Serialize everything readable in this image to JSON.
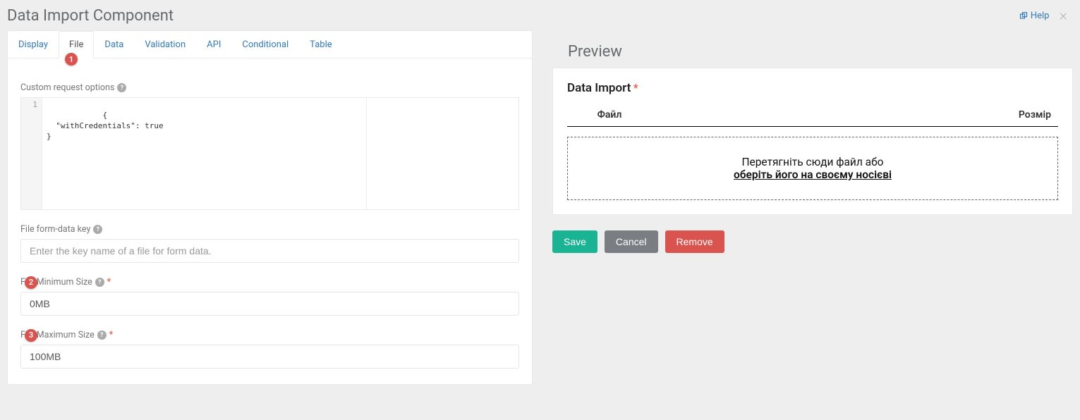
{
  "header": {
    "title": "Data Import Component",
    "help_label": "Help"
  },
  "tabs": {
    "display": "Display",
    "file": "File",
    "data": "Data",
    "validation": "Validation",
    "api": "API",
    "conditional": "Conditional",
    "table": "Table",
    "active": "file"
  },
  "badges": {
    "tab_file": "1",
    "min_size": "2",
    "max_size": "3"
  },
  "form": {
    "custom_request_label": "Custom request options",
    "code_gutter": "1",
    "code_text": "{\n  \"withCredentials\": true\n}",
    "form_data_key_label": "File form-data key",
    "form_data_key_placeholder": "Enter the key name of a file for form data.",
    "form_data_key_value": "",
    "min_size_label": "File Minimum Size",
    "min_size_value": "0MB",
    "max_size_label": "File Maximum Size",
    "max_size_value": "100MB"
  },
  "preview": {
    "title": "Preview",
    "data_import_label": "Data Import",
    "col_file": "Файл",
    "col_size": "Розмір",
    "drop_text": "Перетягніть сюди файл або",
    "browse_text": "оберіть його на своєму носієві"
  },
  "buttons": {
    "save": "Save",
    "cancel": "Cancel",
    "remove": "Remove"
  }
}
